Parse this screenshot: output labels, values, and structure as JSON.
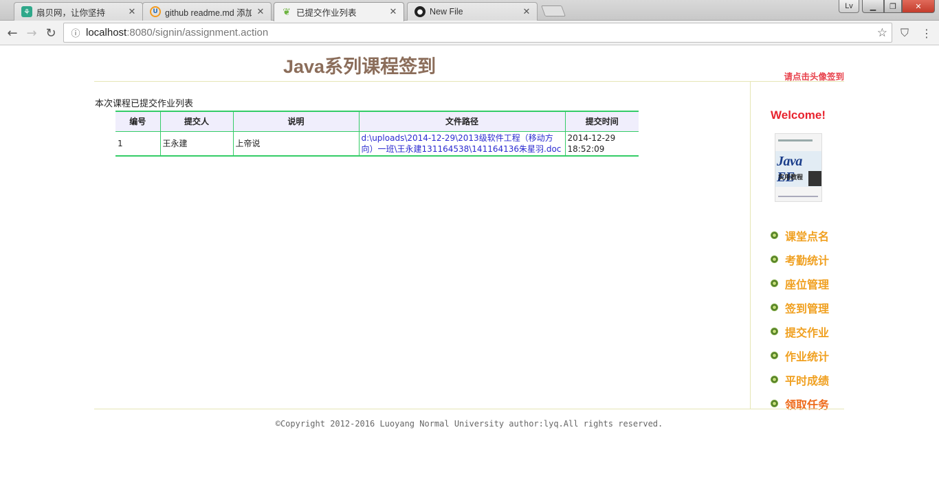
{
  "browser": {
    "tabs": [
      {
        "title": "扇贝网，让你坚持",
        "active": false,
        "favicon": "shanbay-icon",
        "close": "✕"
      },
      {
        "title": "github readme.md 添加",
        "active": false,
        "favicon": "ucweb-icon",
        "close": "✕"
      },
      {
        "title": "已提交作业列表",
        "active": true,
        "favicon": "spring-leaf-icon",
        "close": "✕"
      },
      {
        "title": "New File",
        "active": false,
        "favicon": "github-icon",
        "close": "✕"
      }
    ],
    "user_button": "Lv",
    "url_host": "localhost",
    "url_rest": ":8080/signin/assignment.action"
  },
  "header": {
    "title": "Java系列课程签到",
    "signin_hint": "请点击头像签到"
  },
  "content": {
    "caption": "本次课程已提交作业列表",
    "columns": [
      "编号",
      "提交人",
      "说明",
      "文件路径",
      "提交时间"
    ],
    "rows": [
      {
        "id": "1",
        "submitter": "王永建",
        "note": "上帝说",
        "path_line1": "d:\\uploads\\2014-12-29\\2013级软件工程（移动方",
        "path_line2": "向）一班\\王永建131164538\\141164136朱星羽.doc",
        "date": "2014-12-29",
        "time": "18:52:09"
      }
    ]
  },
  "sidebar": {
    "welcome": "Welcome!",
    "avatar_title": "Java EE",
    "avatar_subtitle": "实用教程",
    "menu": [
      "课堂点名",
      "考勤统计",
      "座位管理",
      "签到管理",
      "提交作业",
      "作业统计",
      "平时成绩",
      "领取任务"
    ]
  },
  "footer": {
    "copyright": "©Copyright 2012-2016 Luoyang Normal University author:lyq.All rights reserved."
  },
  "colors": {
    "title": "#8b6d5a",
    "hint": "#e8434d",
    "table_border": "#33cc66",
    "menu_label": "#f0a020",
    "welcome": "#e8232e"
  }
}
